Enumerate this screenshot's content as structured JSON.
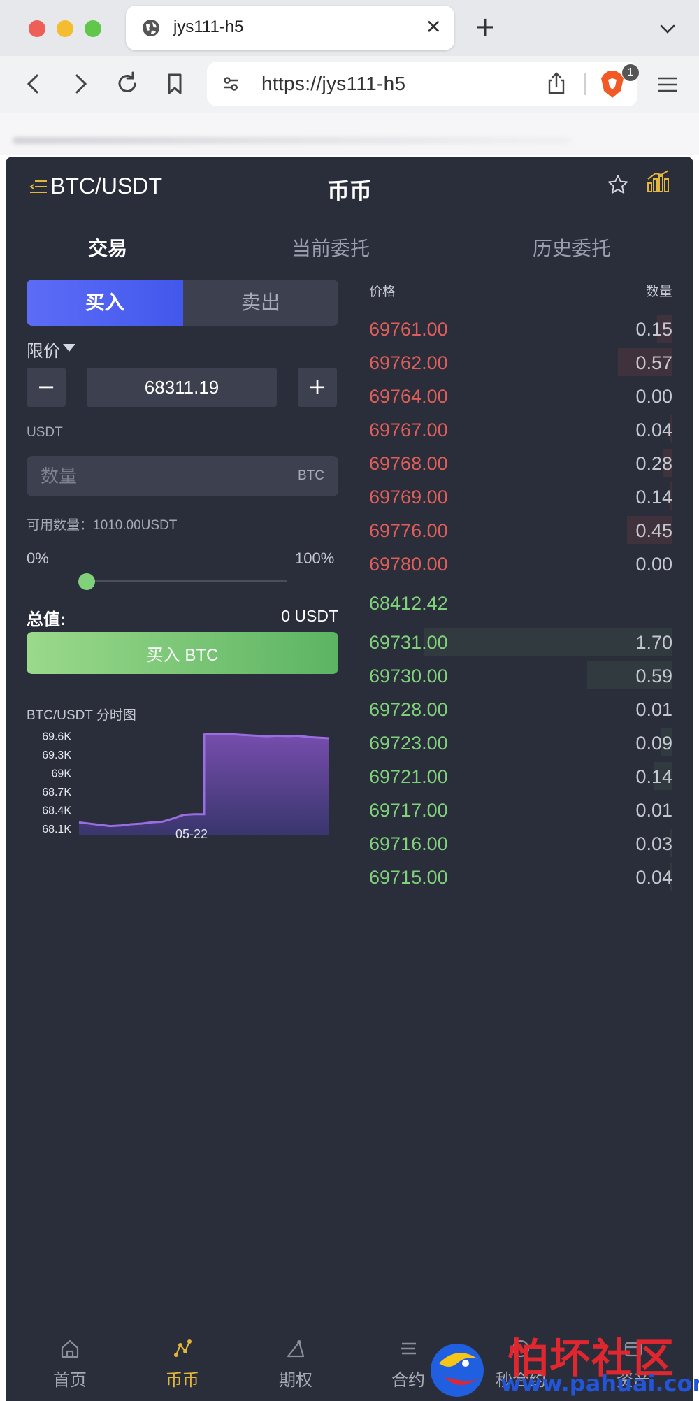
{
  "browser": {
    "tab_title": "jys111-h5",
    "url": "https://jys111-h5",
    "shields_badge": "1"
  },
  "header": {
    "pair": "BTC/USDT",
    "title": "币币"
  },
  "tabs": [
    {
      "label": "交易",
      "active": true
    },
    {
      "label": "当前委托",
      "active": false
    },
    {
      "label": "历史委托",
      "active": false
    }
  ],
  "trade_form": {
    "buy_label": "买入",
    "sell_label": "卖出",
    "order_type": "限价",
    "price_value": "68311.19",
    "minus": "−",
    "plus": "+",
    "unit_label": "USDT",
    "qty_placeholder": "数量",
    "qty_unit": "BTC",
    "available": "可用数量：1010.00USDT",
    "pct_min": "0%",
    "pct_max": "100%",
    "slider_percent": 0,
    "total_label": "总值:",
    "total_value": "0 USDT",
    "buy_button": "买入 BTC"
  },
  "mini_chart": {
    "title": "BTC/USDT 分时图",
    "chart_data": {
      "type": "area",
      "yticks": [
        "69.6K",
        "69.3K",
        "69K",
        "68.7K",
        "68.4K",
        "68.1K"
      ],
      "ytick_values": [
        69600,
        69300,
        69000,
        68700,
        68400,
        68100
      ],
      "ylim": [
        68000,
        69650
      ],
      "xticks": [
        "05-22"
      ],
      "values": [
        68200,
        68180,
        68160,
        68140,
        68150,
        68170,
        68180,
        68200,
        68210,
        68260,
        68320,
        68330,
        69620,
        69630,
        69630,
        69620,
        69610,
        69600,
        69590,
        69600,
        69595,
        69600,
        69580,
        69570,
        69560
      ]
    }
  },
  "order_book": {
    "price_header": "价格",
    "qty_header": "数量",
    "asks": [
      {
        "price": "69761.00",
        "qty": "0.15",
        "depth": 0.05
      },
      {
        "price": "69762.00",
        "qty": "0.57",
        "depth": 0.18
      },
      {
        "price": "69764.00",
        "qty": "0.00",
        "depth": 0.0
      },
      {
        "price": "69767.00",
        "qty": "0.04",
        "depth": 0.01
      },
      {
        "price": "69768.00",
        "qty": "0.28",
        "depth": 0.03
      },
      {
        "price": "69769.00",
        "qty": "0.14",
        "depth": 0.01
      },
      {
        "price": "69776.00",
        "qty": "0.45",
        "depth": 0.15
      },
      {
        "price": "69780.00",
        "qty": "0.00",
        "depth": 0.0
      }
    ],
    "last_price": "68412.42",
    "bids": [
      {
        "price": "69731.00",
        "qty": "1.70",
        "depth": 0.82
      },
      {
        "price": "69730.00",
        "qty": "0.59",
        "depth": 0.28
      },
      {
        "price": "69728.00",
        "qty": "0.01",
        "depth": 0.0
      },
      {
        "price": "69723.00",
        "qty": "0.09",
        "depth": 0.04
      },
      {
        "price": "69721.00",
        "qty": "0.14",
        "depth": 0.06
      },
      {
        "price": "69717.00",
        "qty": "0.01",
        "depth": 0.0
      },
      {
        "price": "69716.00",
        "qty": "0.03",
        "depth": 0.01
      },
      {
        "price": "69715.00",
        "qty": "0.04",
        "depth": 0.01
      }
    ]
  },
  "bottom_nav": [
    {
      "label": "首页",
      "icon": "home-icon",
      "active": false
    },
    {
      "label": "币币",
      "icon": "coin-icon",
      "active": true
    },
    {
      "label": "期权",
      "icon": "option-icon",
      "active": false
    },
    {
      "label": "合约",
      "icon": "contract-icon",
      "active": false
    },
    {
      "label": "秒合约",
      "icon": "second-contract-icon",
      "active": false
    },
    {
      "label": "资产",
      "icon": "assets-icon",
      "active": false
    }
  ],
  "watermark": {
    "text": "怕坏社区",
    "url": "www.pahuai.com"
  },
  "colors": {
    "background": "#2a2d3a",
    "ask": "#e05e5a",
    "bid": "#7fd27a",
    "buy_tab": "#5c6cf6",
    "accent": "#e2b53b"
  }
}
